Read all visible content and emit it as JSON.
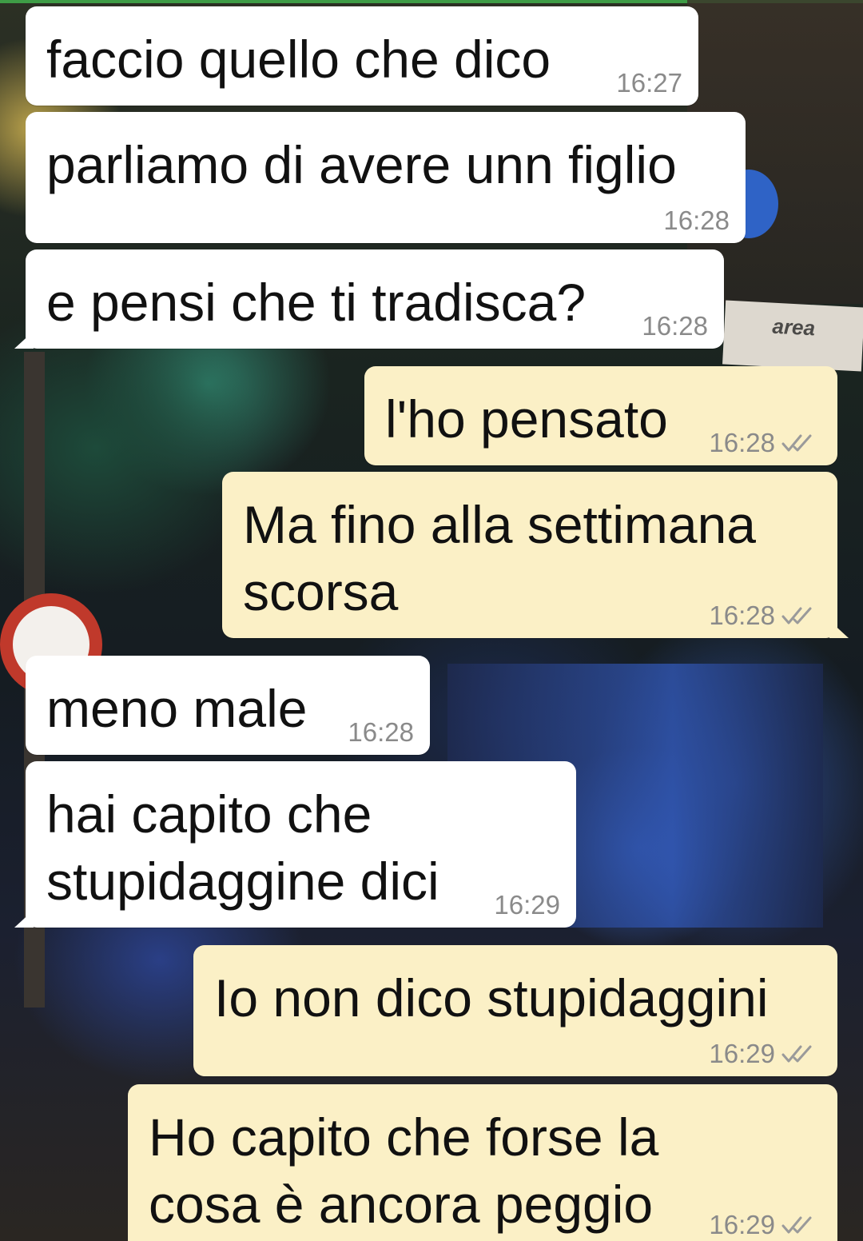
{
  "messages": [
    {
      "dir": "in",
      "text": "faccio quello che dico",
      "time": "16:27"
    },
    {
      "dir": "in",
      "text": "parliamo di avere unn figlio",
      "time": "16:28"
    },
    {
      "dir": "in",
      "text": "e pensi che ti tradisca?",
      "time": "16:28"
    },
    {
      "dir": "out",
      "text": "l'ho pensato",
      "time": "16:28",
      "status": "read-ticks-icon"
    },
    {
      "dir": "out",
      "text": "Ma fino alla settimana\nscorsa",
      "time": "16:28",
      "status": "read-ticks-icon"
    },
    {
      "dir": "in",
      "text": "meno male",
      "time": "16:28"
    },
    {
      "dir": "in",
      "text": "hai capito che\nstupidaggine dici",
      "time": "16:29"
    },
    {
      "dir": "out",
      "text": "Io non dico stupidaggini",
      "time": "16:29",
      "status": "read-ticks-icon"
    },
    {
      "dir": "out",
      "text": "Ho capito che forse la\ncosa è ancora peggio",
      "time": "16:29",
      "status": "read-ticks-icon"
    }
  ],
  "colors": {
    "incoming_bubble": "#ffffff",
    "outgoing_bubble": "#fbf0c6",
    "timestamp": "#8a8a8a",
    "ticks": "#9a9a9a"
  },
  "wallpaper": {
    "sign_text": "area"
  }
}
